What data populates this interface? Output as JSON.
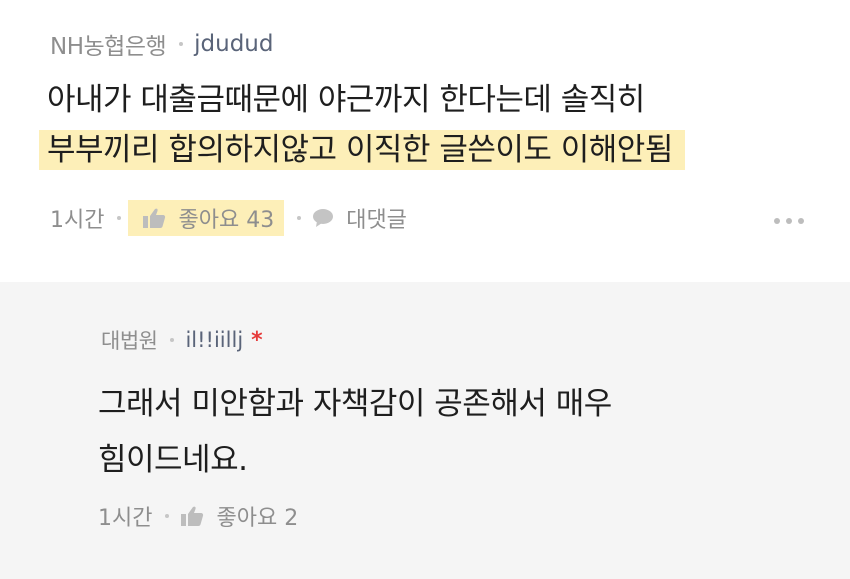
{
  "comment": {
    "company": "NH농협은행",
    "nickname": "jdudud",
    "lines": [
      "아내가 대출금때문에 야근까지 한다는데 솔직히",
      "부부끼리 합의하지않고 이직한 글쓴이도 이해안됨"
    ],
    "time": "1시간",
    "like_label": "좋아요 43",
    "reply_label": "대댓글",
    "highlight_color": "#fdefb8"
  },
  "reply": {
    "company": "대법원",
    "nickname": "il!!iillj",
    "asterisk": "*",
    "lines": [
      "그래서 미안함과 자책감이 공존해서 매우",
      "힘이드네요."
    ],
    "time": "1시간",
    "like_label": "좋아요 2",
    "background": "#f5f5f5"
  },
  "icons": [
    "thumbs-up-icon",
    "speech-bubble-icon",
    "more-options-icon"
  ]
}
